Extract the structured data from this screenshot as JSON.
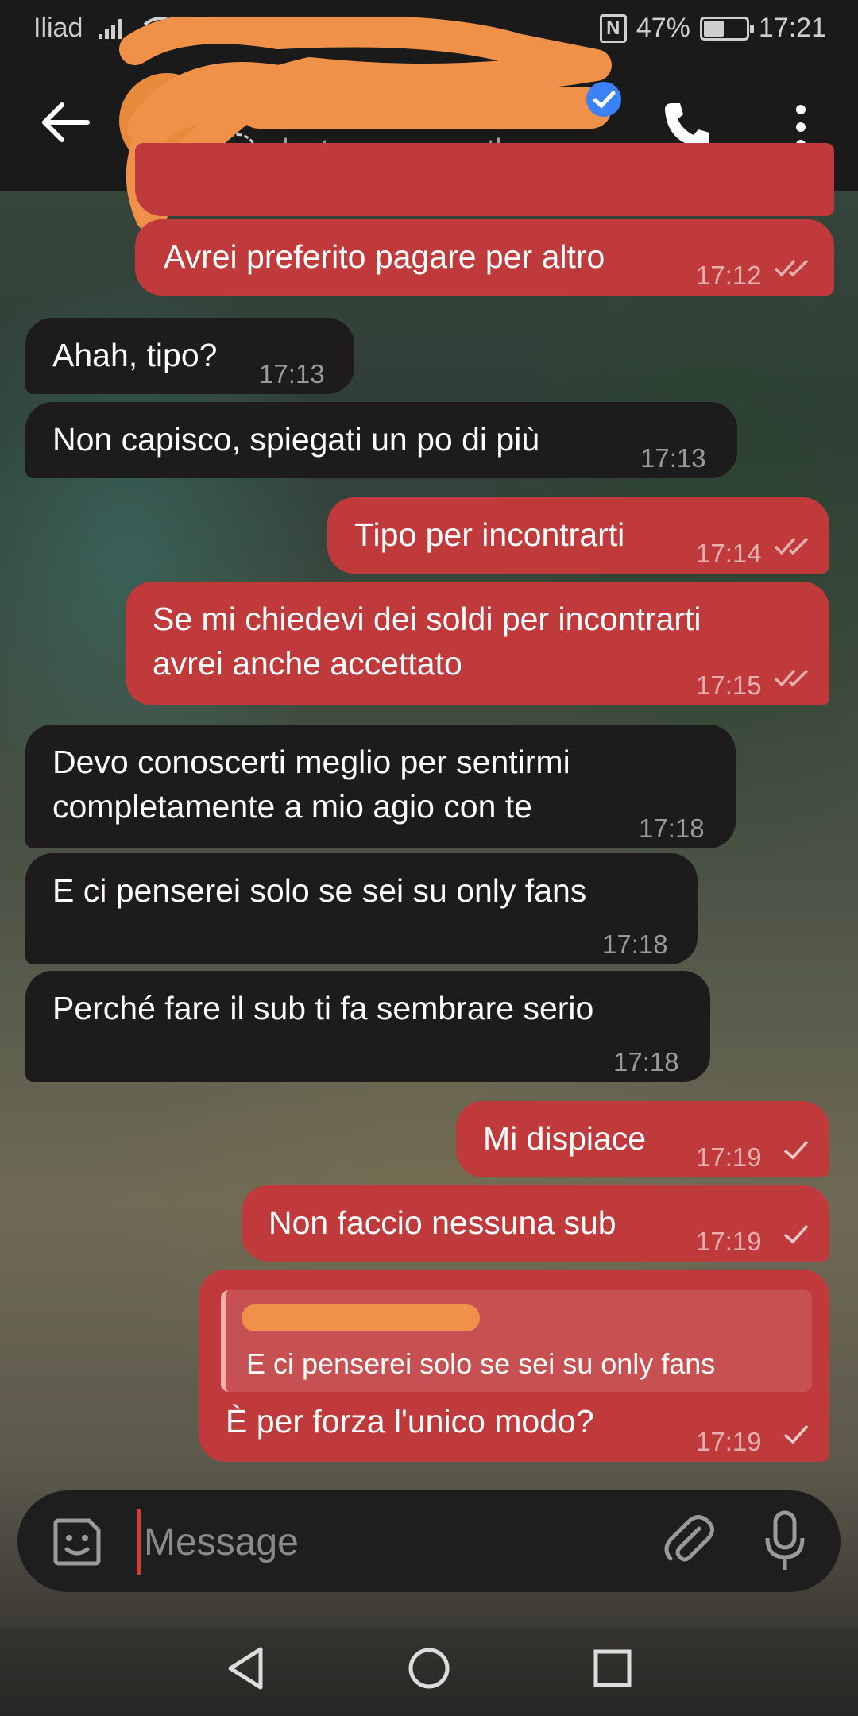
{
  "status_bar": {
    "carrier": "Iliad",
    "battery": "47%",
    "time": "17:21"
  },
  "header": {
    "last_seen": "last seen recently",
    "status_icon_letter": "S"
  },
  "messages": [
    {
      "dir": "out",
      "text": "Avrei preferito pagare per altro",
      "time": "17:12",
      "status": "read"
    },
    {
      "dir": "in",
      "text": "Ahah, tipo?",
      "time": "17:13"
    },
    {
      "dir": "in",
      "text": "Non capisco, spiegati un po di più",
      "time": "17:13"
    },
    {
      "dir": "out",
      "text": "Tipo per incontrarti",
      "time": "17:14",
      "status": "read"
    },
    {
      "dir": "out",
      "lines": [
        "Se mi chiedevi dei soldi per incontrarti",
        "avrei anche accettato"
      ],
      "time": "17:15",
      "status": "read"
    },
    {
      "dir": "in",
      "lines": [
        "Devo conoscerti meglio per sentirmi",
        "completamente a mio agio con te"
      ],
      "time": "17:18"
    },
    {
      "dir": "in",
      "text": "E ci penserei solo se sei su only fans",
      "time": "17:18"
    },
    {
      "dir": "in",
      "text": "Perché fare il sub ti fa sembrare serio",
      "time": "17:18"
    },
    {
      "dir": "out",
      "text": "Mi dispiace",
      "time": "17:19",
      "status": "sent"
    },
    {
      "dir": "out",
      "text": "Non faccio nessuna sub",
      "time": "17:19",
      "status": "sent"
    },
    {
      "dir": "out",
      "reply_to": "E ci penserei solo se sei su only fans",
      "text": "È per forza l'unico modo?",
      "time": "17:19",
      "status": "sent"
    }
  ],
  "composer": {
    "placeholder": "Message"
  },
  "colors": {
    "outgoing": "#c0393b",
    "incoming": "#1e1b1c",
    "header": "#1a1a1a"
  }
}
